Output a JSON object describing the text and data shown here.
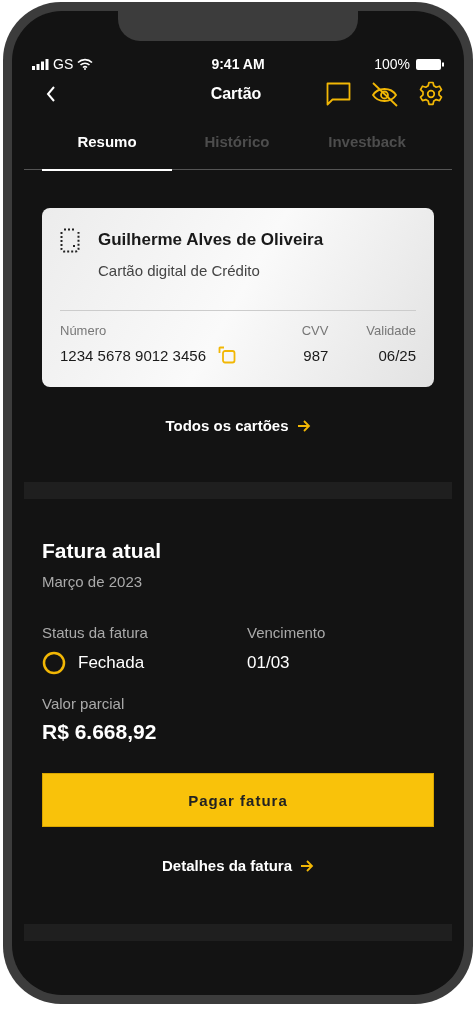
{
  "status_bar": {
    "carrier": "GS",
    "time": "9:41 AM",
    "battery": "100%"
  },
  "header": {
    "title": "Cartão"
  },
  "tabs": [
    {
      "label": "Resumo",
      "selected": true
    },
    {
      "label": "Histórico",
      "selected": false
    },
    {
      "label": "Investback",
      "selected": false
    }
  ],
  "card": {
    "holder": "Guilherme Alves de Oliveira",
    "type": "Cartão digital de Crédito",
    "fields": [
      {
        "label": "Número",
        "value": "1234 5678 9012 3456"
      },
      {
        "label": "CVV",
        "value": "987"
      },
      {
        "label": "Validade",
        "value": "06/25"
      }
    ]
  },
  "all_cards_link": "Todos os cartões",
  "invoice": {
    "title": "Fatura atual",
    "month": "Março de 2023",
    "status_label": "Status da fatura",
    "status": "Fechada",
    "due_label": "Vencimento",
    "due": "01/03",
    "amount_label": "Valor parcial",
    "amount": "R$ 6.668,92",
    "pay_button": "Pagar fatura",
    "details_link": "Detalhes da fatura"
  }
}
